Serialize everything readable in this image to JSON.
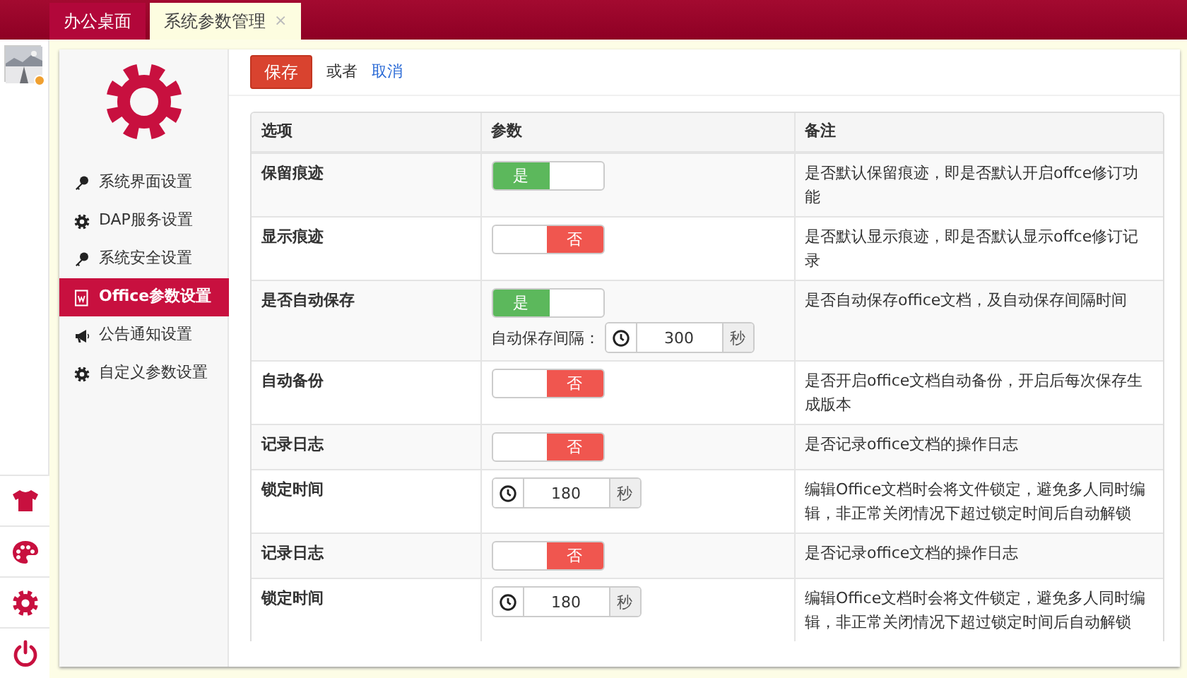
{
  "tabs": [
    {
      "label": "办公桌面",
      "selected": false
    },
    {
      "label": "系统参数管理",
      "selected": true,
      "close": "×"
    }
  ],
  "rail": {
    "tools": [
      {
        "kind": "shirt"
      },
      {
        "kind": "palette"
      },
      {
        "kind": "gear"
      },
      {
        "kind": "power"
      }
    ]
  },
  "settings_menu": [
    {
      "label": "系统界面设置",
      "selected": false
    },
    {
      "label": "DAP服务设置",
      "selected": false
    },
    {
      "label": "系统安全设置",
      "selected": false
    },
    {
      "label": "Office参数设置",
      "selected": true
    },
    {
      "label": "公告通知设置",
      "selected": false
    },
    {
      "label": "自定义参数设置",
      "selected": false
    }
  ],
  "toolbar": {
    "save": "保存",
    "or": "或者",
    "cancel": "取消"
  },
  "table": {
    "columns": [
      "选项",
      "参数",
      "备注"
    ],
    "rows": [
      {
        "option": "保留痕迹",
        "kind": "toggle",
        "on": true,
        "label": "是",
        "note": "是否默认保留痕迹，即是否默认开启offce修订功能"
      },
      {
        "option": "显示痕迹",
        "kind": "toggle",
        "on": false,
        "label": "否",
        "note": "是否默认显示痕迹，即是否默认显示offce修订记录"
      },
      {
        "option": "是否自动保存",
        "kind": "toggle",
        "on": true,
        "label": "是",
        "interval": {
          "label": "自动保存间隔：",
          "value": "300",
          "unit": "秒"
        },
        "note": "是否自动保存office文档，及自动保存间隔时间"
      },
      {
        "option": "自动备份",
        "kind": "toggle",
        "on": false,
        "label": "否",
        "note": "是否开启office文档自动备份，开启后每次保存生成版本"
      },
      {
        "option": "记录日志",
        "kind": "toggle",
        "on": false,
        "label": "否",
        "note": "是否记录office文档的操作日志"
      },
      {
        "option": "锁定时间",
        "kind": "number",
        "value": "180",
        "unit": "秒",
        "note": "编辑Office文档时会将文件锁定，避免多人同时编辑，非正常关闭情况下超过锁定时间后自动解锁"
      },
      {
        "option": "记录日志",
        "kind": "toggle",
        "on": false,
        "label": "否",
        "note": "是否记录office文档的操作日志"
      },
      {
        "option": "锁定时间",
        "kind": "number",
        "value": "180",
        "unit": "秒",
        "note": "编辑Office文档时会将文件锁定，避免多人同时编辑，非正常关闭情况下超过锁定时间后自动解锁"
      }
    ]
  }
}
